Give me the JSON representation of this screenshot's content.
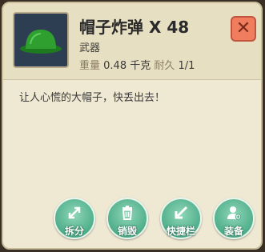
{
  "item": {
    "name": "帽子炸弹 X 48",
    "type": "武器",
    "weight_label": "重量",
    "weight_value": "0.48 千克",
    "durability_label": "耐久",
    "durability_value": "1/1",
    "icon": "green-helmet-icon",
    "description": "让人心慌的大帽子，快丢出去！"
  },
  "close": {
    "icon": "close-icon",
    "label": "✕"
  },
  "actions": [
    {
      "icon": "split-arrows-icon",
      "label": "拆分"
    },
    {
      "icon": "trash-icon",
      "label": "销毁"
    },
    {
      "icon": "arrow-icon",
      "label": "快捷栏"
    },
    {
      "icon": "equip-person-icon",
      "label": "装备"
    }
  ],
  "colors": {
    "panel": "#efe9d3",
    "close": "#ef7d5e",
    "action": "#4fae8a"
  }
}
